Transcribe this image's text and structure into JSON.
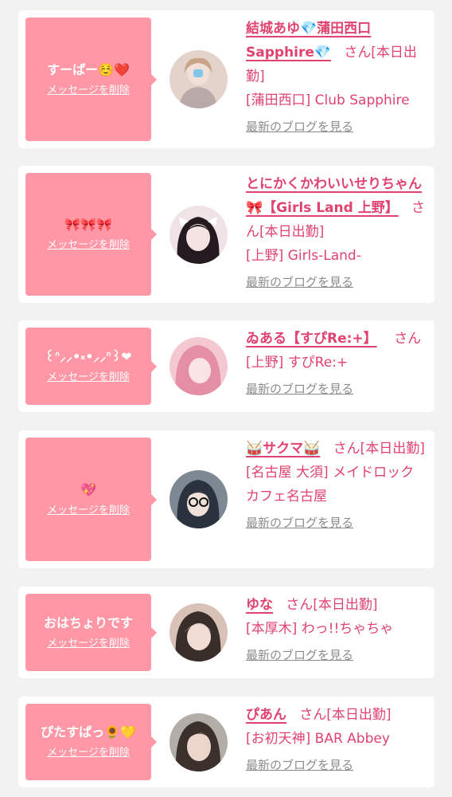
{
  "cards": [
    {
      "message": "すーぱー☺️❤️",
      "delete_label": "メッセージを削除",
      "name": "結城あゆ💎蒲田西口Sapphire💎",
      "suffix": "さん[本日出勤]",
      "shop": "[蒲田西口] Club Sapphire",
      "blog_label": "最新のブログを見る",
      "avatar_colors": [
        "#d9c7bd",
        "#b69d95",
        "#eadfd9"
      ]
    },
    {
      "message": "🎀🎀🎀",
      "delete_label": "メッセージを削除",
      "name": "とにかくかわいいせりちゃん🎀【Girls Land 上野】",
      "suffix": "さん[本日出勤]",
      "shop": "[上野] Girls-Land-",
      "blog_label": "最新のブログを見る",
      "avatar_colors": [
        "#f4e8ea",
        "#241c20",
        "#f3d6dc"
      ]
    },
    {
      "message": "꒰ᐢ⸝⸝•༝•⸝⸝ᐢ꒱❤",
      "delete_label": "メッセージを削除",
      "name": "ゐある【すぴRe:+】",
      "suffix": "さん",
      "shop": "[上野] すぴRe:+",
      "blog_label": "最新のブログを見る",
      "avatar_colors": [
        "#e8a2b4",
        "#f7c9d2",
        "#c47689"
      ]
    },
    {
      "message": "💖",
      "delete_label": "メッセージを削除",
      "name": "🥁サクマ🥁",
      "suffix": "さん[本日出勤]",
      "shop": "[名古屋 大須] メイドロックカフェ名古屋",
      "blog_label": "最新のブログを見る",
      "avatar_colors": [
        "#6e7a86",
        "#2d3640",
        "#e9dcd5"
      ]
    },
    {
      "message": "おはちょりです",
      "delete_label": "メッセージを削除",
      "name": "ゆな",
      "suffix": "さん[本日出勤]",
      "shop": "[本厚木] わっ!!ちゃちゃ",
      "blog_label": "最新のブログを見る",
      "avatar_colors": [
        "#3a2e2b",
        "#d8b4a7",
        "#eedbd2"
      ]
    },
    {
      "message": "ぴたすぱっ🌻💛",
      "delete_label": "メッセージを削除",
      "name": "ぴあん",
      "suffix": "さん[本日出勤]",
      "shop": "[お初天神] BAR Abbey",
      "blog_label": "最新のブログを見る",
      "avatar_colors": [
        "#a5a19c",
        "#3b302c",
        "#e8d2c7"
      ]
    }
  ]
}
